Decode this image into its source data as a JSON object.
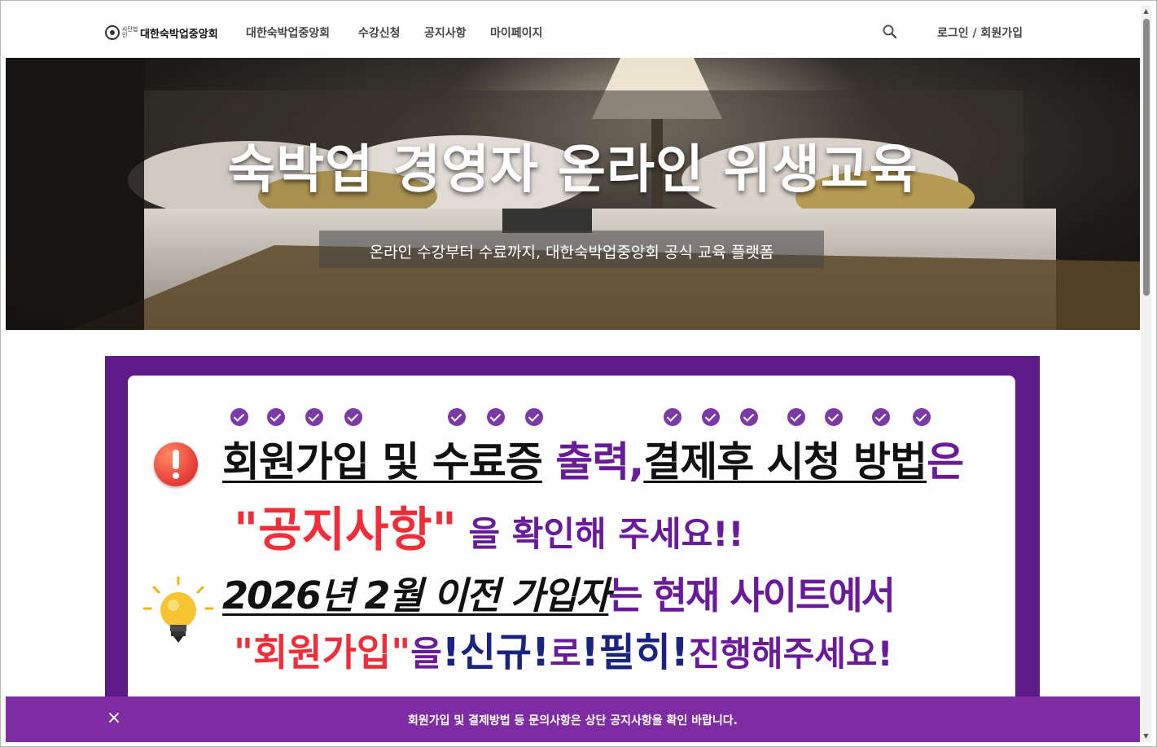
{
  "header": {
    "logo_prefix": "사단법인",
    "logo_name": "대한숙박업중앙회",
    "nav": [
      "대한숙박업중앙회",
      "수강신청",
      "공지사항",
      "마이페이지"
    ],
    "login": "로그인 / 회원가입",
    "search_icon": "search-icon"
  },
  "hero": {
    "title": "숙박업 경영자 온라인 위생교육",
    "subtitle": "온라인 수강부터 수료까지, 대한숙박업중앙회 공식 교육 플랫폼"
  },
  "notice": {
    "line1": {
      "u1": "회원가입 및 수료증",
      "p1": " 출력,",
      "u2": "결제후 시청 방법",
      "p2": "은"
    },
    "line2": {
      "r": "\"공지사항\"",
      "p": " 을 확인해 주세요!!"
    },
    "line3": {
      "u": "2026년 2월 이전 가입자",
      "p": "는 현재 사이트에서"
    },
    "line4": {
      "r": "\"회원가입\"",
      "p1": "을",
      "b": "!신규!",
      "p2": "로",
      "b2": "!필히!",
      "p3": "진행해주세요!"
    },
    "colors": {
      "purple": "#6a1b9a",
      "red": "#f02e3a",
      "navy": "#1a237e",
      "frame": "#5f1a8a"
    }
  },
  "bottom_bar": {
    "text": "회원가입 및 결제방법 등 문의사항은 상단 공지사항을 확인 바랍니다.",
    "close": "×",
    "color": "#7e2ca3"
  }
}
